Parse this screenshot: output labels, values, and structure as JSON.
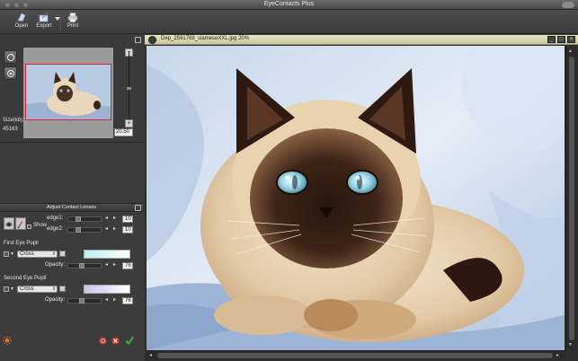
{
  "app": {
    "title": "EyeContacts Plus"
  },
  "toolbar": {
    "open_label": "Open",
    "export_label": "Export",
    "print_label": "Print"
  },
  "navigator": {
    "size_label": "Size(kb):",
    "size_value": "45163",
    "zoom_value": "20.50",
    "zoom_minus": "−",
    "zoom_plus": "+"
  },
  "adjust": {
    "title": "Adjust Contact Lenses",
    "show_label": "Show",
    "edge1_label": "edge1:",
    "edge1_value": "10",
    "edge2_label": "edge2:",
    "edge2_value": "10",
    "first_eye": {
      "label": "First Eye Pupil",
      "style": "Cross",
      "opacity_label": "Opacity:",
      "opacity_value": "76",
      "gradient_from": "#b9f1ee",
      "gradient_to": "#ffffff"
    },
    "second_eye": {
      "label": "Second Eye Pupil",
      "style": "Cross",
      "opacity_label": "Opacity:",
      "opacity_value": "76",
      "gradient_from": "#cfc0ea",
      "gradient_to": "#ffffff"
    }
  },
  "image_window": {
    "title": "Dep_2591768_siameseXXL.jpg 20%"
  },
  "colors": {
    "accent_red": "#d23a2f",
    "accent_green": "#3db23b",
    "selection_red": "#e0203a"
  }
}
